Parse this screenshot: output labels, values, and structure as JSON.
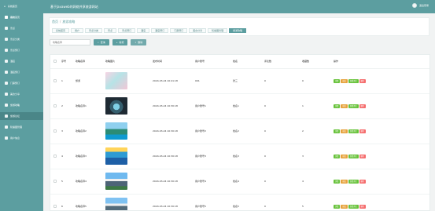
{
  "header": {
    "logo_text": "系统首页",
    "title": "基于Javaweb的网络共享旅游网站",
    "user_text": "退出登录"
  },
  "sidebar": {
    "items": [
      {
        "label": "系统首页"
      },
      {
        "label": "用户"
      },
      {
        "label": "景点"
      },
      {
        "label": "景点分类"
      },
      {
        "label": "景点预订"
      },
      {
        "label": "酒店"
      },
      {
        "label": "酒店预订"
      },
      {
        "label": "门票预订"
      },
      {
        "label": "美食分享"
      },
      {
        "label": "旅游攻略"
      },
      {
        "label": "旅游论坛"
      },
      {
        "label": "轮播图管理"
      },
      {
        "label": "用户信息"
      }
    ]
  },
  "breadcrumb": {
    "home": "首页",
    "separator": "/",
    "current": "旅游攻略"
  },
  "tabs": [
    {
      "label": "系统首页"
    },
    {
      "label": "用户"
    },
    {
      "label": "景点分类"
    },
    {
      "label": "景点"
    },
    {
      "label": "景点预订"
    },
    {
      "label": "酒店"
    },
    {
      "label": "酒店预订"
    },
    {
      "label": "门票预订"
    },
    {
      "label": "美食分享"
    },
    {
      "label": "轮播图管理"
    },
    {
      "label": "旅游攻略"
    }
  ],
  "toolbar": {
    "search_placeholder": "攻略名称",
    "search_button": "查询",
    "add_button": "新增",
    "delete_button": "删除"
  },
  "table": {
    "columns": [
      "",
      "序号",
      "攻略名称",
      "攻略图片",
      "发布时间",
      "用户账号",
      "姓名",
      "评论数",
      "收藏数",
      "操作"
    ],
    "rows": [
      {
        "index": "1",
        "name": "旅游",
        "time": "2024-03-24 10:41:18",
        "account": "001",
        "owner": "张三",
        "comments": "0",
        "favorites": "0"
      },
      {
        "index": "2",
        "name": "攻略名称1",
        "time": "2024-03-24 10:30:18",
        "account": "用户账号1",
        "owner": "姓名1",
        "comments": "0",
        "favorites": "1"
      },
      {
        "index": "3",
        "name": "攻略名称2",
        "time": "2024-03-24 10:30:18",
        "account": "用户账号2",
        "owner": "姓名2",
        "comments": "0",
        "favorites": "2"
      },
      {
        "index": "4",
        "name": "攻略名称3",
        "time": "2024-03-24 10:30:18",
        "account": "用户账号3",
        "owner": "姓名3",
        "comments": "0",
        "favorites": "3"
      },
      {
        "index": "5",
        "name": "攻略名称4",
        "time": "2024-03-24 10:30:18",
        "account": "用户账号4",
        "owner": "姓名4",
        "comments": "0",
        "favorites": "4"
      },
      {
        "index": "6",
        "name": "攻略名称5",
        "time": "2024-03-24 10:30:18",
        "account": "用户账号5",
        "owner": "姓名5",
        "comments": "0",
        "favorites": "5"
      }
    ],
    "ops": {
      "detail": "详情",
      "edit": "修改",
      "comment": "查看评论",
      "delete": "删除"
    }
  },
  "colors": {
    "theme": "#5c9ea0",
    "success": "#67c23a",
    "warning": "#e6a23c",
    "danger": "#f56c6c"
  }
}
